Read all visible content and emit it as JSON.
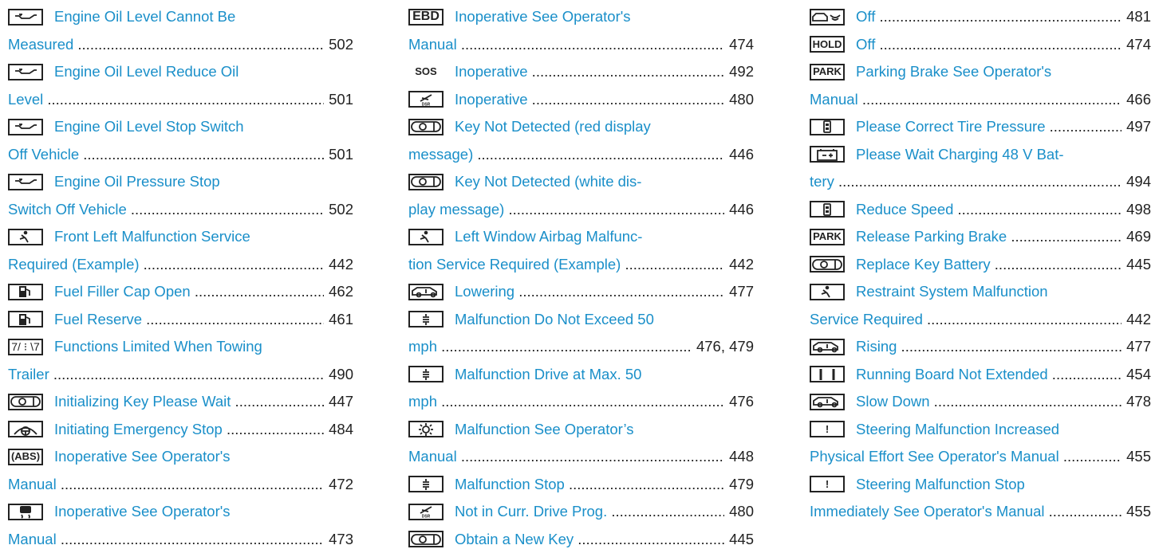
{
  "col1": [
    {
      "icon_name": "oil-can-icon",
      "lines": [
        "Engine Oil Level Cannot Be",
        "Measured"
      ],
      "page": "502"
    },
    {
      "icon_name": "oil-can-icon",
      "lines": [
        "Engine Oil Level Reduce Oil",
        "Level"
      ],
      "page": "501"
    },
    {
      "icon_name": "oil-can-icon",
      "lines": [
        "Engine Oil Level Stop Switch",
        "Off Vehicle"
      ],
      "page": "501"
    },
    {
      "icon_name": "oil-can-icon",
      "lines": [
        "Engine Oil Pressure Stop",
        "Switch Off Vehicle"
      ],
      "page": "502"
    },
    {
      "icon_name": "airbag-icon",
      "lines": [
        "Front Left Malfunction Service",
        "Required (Example)"
      ],
      "page": "442"
    },
    {
      "icon_name": "fuel-pump-icon",
      "lines": [
        "Fuel Filler Cap Open"
      ],
      "page": "462"
    },
    {
      "icon_name": "fuel-pump-icon",
      "lines": [
        "Fuel Reserve"
      ],
      "page": "461"
    },
    {
      "icon_name": "towing-trailer-icon",
      "icon_text": "7/ ⁝ \\7",
      "lines": [
        "Functions Limited When Towing",
        "Trailer"
      ],
      "page": "490"
    },
    {
      "icon_name": "key-icon",
      "lines": [
        "Initializing Key Please Wait"
      ],
      "page": "447"
    },
    {
      "icon_name": "steering-assist-icon",
      "lines": [
        "Initiating Emergency Stop"
      ],
      "page": "484"
    },
    {
      "icon_name": "abs-icon",
      "icon_text": "(ABS)",
      "lines": [
        "Inoperative See Operator's",
        "Manual"
      ],
      "page": "472"
    },
    {
      "icon_name": "skid-car-icon",
      "lines": [
        "Inoperative See Operator's",
        "Manual"
      ],
      "page": "473"
    }
  ],
  "col2": [
    {
      "icon_name": "ebd-icon",
      "icon_text": "EBD",
      "lines": [
        "Inoperative See Operator's",
        "Manual"
      ],
      "page": "474"
    },
    {
      "icon_name": "sos-icon",
      "icon_text": "SOS",
      "lines": [
        "Inoperative"
      ],
      "page": "492"
    },
    {
      "icon_name": "dsr-icon",
      "lines": [
        "Inoperative"
      ],
      "page": "480"
    },
    {
      "icon_name": "key-icon",
      "lines": [
        "Key Not Detected  (red display",
        "message)"
      ],
      "page": "446"
    },
    {
      "icon_name": "key-icon",
      "lines": [
        "Key Not Detected  (white dis-",
        "play message)"
      ],
      "page": "446"
    },
    {
      "icon_name": "airbag-icon",
      "lines": [
        "Left Window Airbag Malfunc-",
        "tion Service Required (Example)"
      ],
      "page": "442"
    },
    {
      "icon_name": "vehicle-level-icon",
      "lines": [
        "Lowering"
      ],
      "page": "477"
    },
    {
      "icon_name": "suspension-icon",
      "lines": [
        "Malfunction Do Not Exceed 50",
        "mph"
      ],
      "page": "476, 479"
    },
    {
      "icon_name": "suspension-icon",
      "lines": [
        "Malfunction Drive at Max. 50",
        "mph"
      ],
      "page": "476"
    },
    {
      "icon_name": "light-icon",
      "lines": [
        "Malfunction See Operator’s",
        "Manual"
      ],
      "page": "448"
    },
    {
      "icon_name": "suspension-icon",
      "lines": [
        "Malfunction Stop"
      ],
      "page": "479"
    },
    {
      "icon_name": "dsr-icon",
      "lines": [
        "Not in Curr. Drive Prog."
      ],
      "page": "480"
    },
    {
      "icon_name": "key-icon",
      "lines": [
        "Obtain a New Key"
      ],
      "page": "445"
    }
  ],
  "col3": [
    {
      "icon_name": "distance-assist-icon",
      "lines": [
        "Off"
      ],
      "page": "481"
    },
    {
      "icon_name": "hold-icon",
      "icon_text": "HOLD",
      "lines": [
        "Off"
      ],
      "page": "474"
    },
    {
      "icon_name": "park-icon",
      "icon_text": "PARK",
      "lines": [
        "Parking Brake See Operator's",
        "Manual"
      ],
      "page": "466"
    },
    {
      "icon_name": "tire-pressure-icon",
      "lines": [
        "Please Correct Tire Pressure"
      ],
      "page": "497"
    },
    {
      "icon_name": "battery-icon",
      "lines": [
        "Please Wait Charging 48 V Bat-",
        "tery"
      ],
      "page": "494"
    },
    {
      "icon_name": "tire-pressure-icon",
      "lines": [
        "Reduce Speed"
      ],
      "page": "498"
    },
    {
      "icon_name": "park-icon",
      "icon_text": "PARK",
      "lines": [
        "Release Parking Brake"
      ],
      "page": "469"
    },
    {
      "icon_name": "key-icon",
      "lines": [
        "Replace Key Battery"
      ],
      "page": "445"
    },
    {
      "icon_name": "airbag-icon",
      "lines": [
        "Restraint System Malfunction",
        "Service Required"
      ],
      "page": "442"
    },
    {
      "icon_name": "vehicle-level-icon",
      "lines": [
        "Rising"
      ],
      "page": "477"
    },
    {
      "icon_name": "running-board-icon",
      "lines": [
        "Running Board Not Extended"
      ],
      "page": "454"
    },
    {
      "icon_name": "vehicle-level-icon",
      "lines": [
        "Slow Down"
      ],
      "page": "478"
    },
    {
      "icon_name": "steering-warning-icon",
      "icon_text": "!",
      "lines": [
        "Steering Malfunction Increased",
        "Physical Effort See Operator's Manual"
      ],
      "page": "455"
    },
    {
      "icon_name": "steering-warning-icon",
      "icon_text": "!",
      "lines": [
        "Steering Malfunction Stop",
        "Immediately See Operator's Manual"
      ],
      "page": "455"
    }
  ]
}
